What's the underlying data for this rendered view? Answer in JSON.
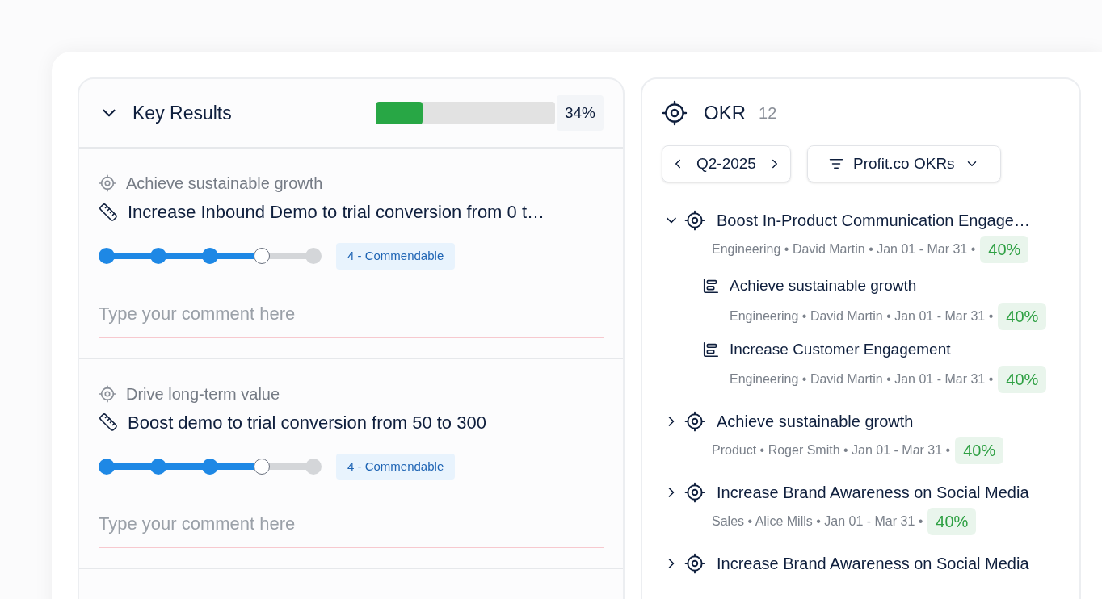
{
  "key_results": {
    "title": "Key Results",
    "expanded": true,
    "level": 0.26,
    "percent": "34%",
    "items": [
      {
        "objective": "Achieve sustainable growth",
        "title": "Increase Inbound Demo to trial conversion from 0 t…",
        "level": 0.75,
        "rating": "4 - Commendable",
        "comment_placeholder": "Type your comment here"
      },
      {
        "objective": "Drive long-term value",
        "title": "Boost demo to trial conversion from 50 to 300",
        "level": 0.75,
        "rating": "4 - Commendable",
        "comment_placeholder": "Type your comment here"
      }
    ]
  },
  "okr": {
    "title": "OKR",
    "count": "12",
    "period": "Q2-2025",
    "filter": "Profit.co OKRs",
    "items": [
      {
        "title": "Boost In-Product Communication Engage…",
        "meta": "Engineering • David Martin • Jan 01 - Mar 31 •",
        "progress": "40%",
        "expanded": true,
        "children": [
          {
            "title": "Achieve sustainable growth",
            "meta": "Engineering • David Martin • Jan 01 - Mar 31 •",
            "progress": "40%"
          },
          {
            "title": "Increase Customer Engagement",
            "meta": "Engineering • David Martin • Jan 01 - Mar 31 •",
            "progress": "40%"
          }
        ]
      },
      {
        "title": "Achieve sustainable growth",
        "meta": "Product • Roger Smith • Jan 01 - Mar 31 •",
        "progress": "40%",
        "expanded": false
      },
      {
        "title": "Increase Brand Awareness on Social Media",
        "meta": "Sales • Alice Mills • Jan 01 - Mar 31 •",
        "progress": "40%",
        "expanded": false
      },
      {
        "title": "Increase Brand Awareness on Social Media",
        "expanded": false
      }
    ]
  }
}
